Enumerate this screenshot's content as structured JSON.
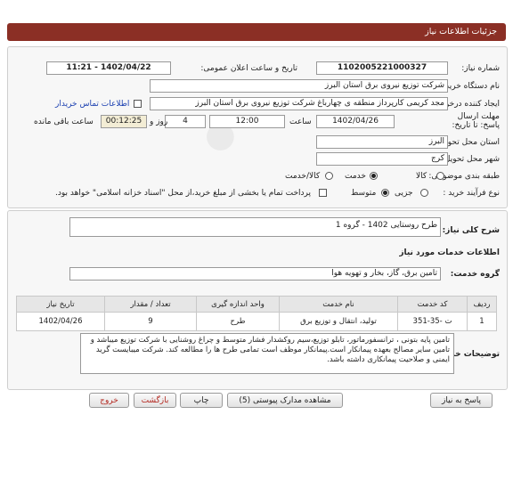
{
  "header": {
    "title": "جزئیات اطلاعات نیاز"
  },
  "fields": {
    "need_number_label": "شماره نیاز:",
    "need_number": "1102005221000327",
    "announce_label": "تاریخ و ساعت اعلان عمومی:",
    "announce_value": "1402/04/22 - 11:21",
    "buyer_org_label": "نام دستگاه خریدار:",
    "buyer_org": "شرکت توزیع نیروی برق استان البرز",
    "creator_label": "ایجاد کننده درخواست:",
    "creator": "مجد کریمی کارپرداز منطقه ی چهارباغ شرکت توزیع نیروی برق استان البرز",
    "contact_link": "اطلاعات تماس خریدار",
    "deadline_label": "مهلت ارسال پاسخ: تا تاریخ:",
    "deadline_date": "1402/04/26",
    "time_label": "ساعت",
    "deadline_time": "12:00",
    "days": "4",
    "days_label": "روز و",
    "remaining": "00:12:25",
    "remaining_label": "ساعت باقی مانده",
    "province_label": "استان محل تحویل:",
    "province": "البرز",
    "city_label": "شهر محل تحویل:",
    "city": "کرج",
    "category_label": "طبقه بندی موضوعی:",
    "category_options": [
      "کالا",
      "خدمت",
      "کالا/خدمت"
    ],
    "process_label": "نوع فرآیند خرید :",
    "process_options": [
      "جزیی",
      "متوسط"
    ],
    "payment_text": "پرداخت تمام یا بخشی از مبلغ خرید،از محل \"اسناد خزانه اسلامی\" خواهد بود."
  },
  "details": {
    "summary_label": "شرح کلی نیاز:",
    "summary": "طرح روستایی 1402 - گروه 1",
    "services_heading": "اطلاعات خدمات مورد نیاز",
    "group_label": "گروه خدمت:",
    "group": "تامین برق، گاز، بخار و تهویه هوا",
    "table": {
      "headers": [
        "ردیف",
        "کد خدمت",
        "نام خدمت",
        "واحد اندازه گیری",
        "تعداد / مقدار",
        "تاریخ نیاز"
      ],
      "rows": [
        [
          "1",
          "ت -35-351",
          "تولید، انتقال و توزیع برق",
          "طرح",
          "9",
          "1402/04/26"
        ]
      ]
    },
    "buyer_notes_label": "توضیحات خریدار:",
    "buyer_notes": "تامین پایه بتونی ، ترانسفورماتور، تابلو توزیع،سیم روکشدار فشار متوسط و چراغ روشنایی با شرکت توزیع میباشد و تامین سایر مصالح بعهده پیمانکار است.پیمانکار موظف است تمامی طرح ها را مطالعه کند. شرکت میبایست گرید ایمنی و صلاحیت پیمانکاری داشته باشد."
  },
  "buttons": {
    "reply": "پاسخ به نیاز",
    "attachments": "مشاهده مدارک پیوستی (5)",
    "print": "چاپ",
    "back": "بازگشت",
    "exit": "خروج"
  }
}
